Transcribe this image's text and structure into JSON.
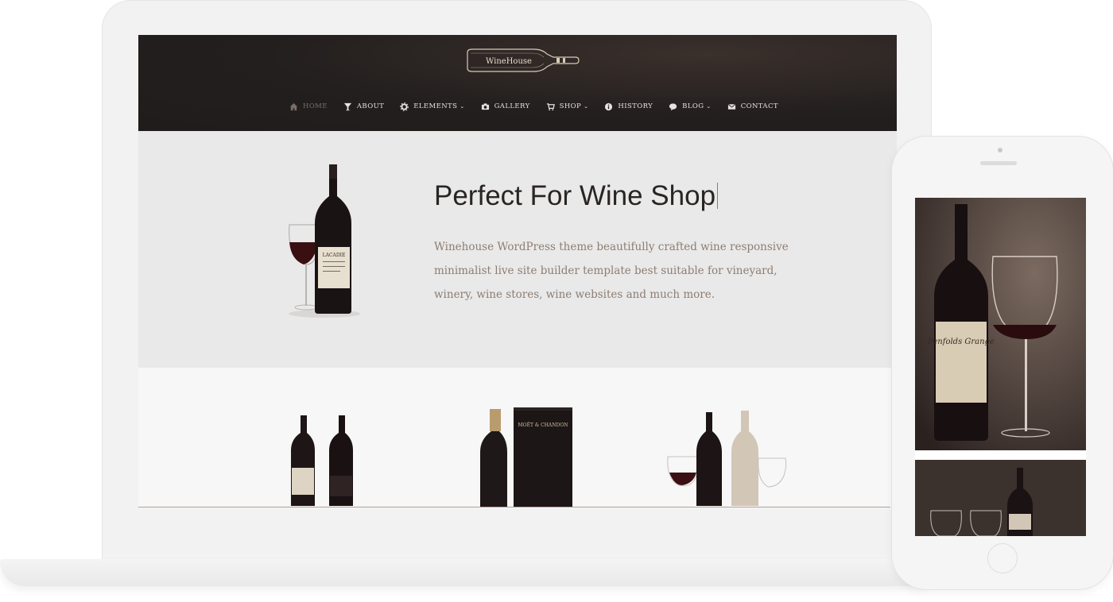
{
  "site": {
    "logo_text": "WineHouse"
  },
  "nav": {
    "items": [
      {
        "label": "HOME",
        "icon": "home-icon",
        "active": true,
        "dropdown": false
      },
      {
        "label": "ABOUT",
        "icon": "glass-icon",
        "active": false,
        "dropdown": false
      },
      {
        "label": "ELEMENTS",
        "icon": "gear-icon",
        "active": false,
        "dropdown": true
      },
      {
        "label": "GALLERY",
        "icon": "camera-icon",
        "active": false,
        "dropdown": false
      },
      {
        "label": "SHOP",
        "icon": "cart-icon",
        "active": false,
        "dropdown": true
      },
      {
        "label": "HISTORY",
        "icon": "info-icon",
        "active": false,
        "dropdown": false
      },
      {
        "label": "BLOG",
        "icon": "comment-icon",
        "active": false,
        "dropdown": true
      },
      {
        "label": "CONTACT",
        "icon": "envelope-icon",
        "active": false,
        "dropdown": false
      }
    ],
    "caret": "⌄"
  },
  "hero": {
    "title": "Perfect For Wine Shop",
    "description": "Winehouse WordPress theme beautifully crafted wine responsive minimalist live site builder template best suitable for vineyard, winery, wine stores, wine websites and much more.",
    "bottle_label": "LACADIE"
  },
  "products": {
    "box_label": "MOËT & CHANDON"
  },
  "phone": {
    "bottle_label": "Penfolds Grange"
  },
  "colors": {
    "header_bg": "#231f1e",
    "hero_bg": "#e9e9e9",
    "nav_text": "#e7e2df",
    "nav_active": "#7a6d67",
    "title_text": "#2a2523",
    "desc_text": "#8e7d72"
  }
}
